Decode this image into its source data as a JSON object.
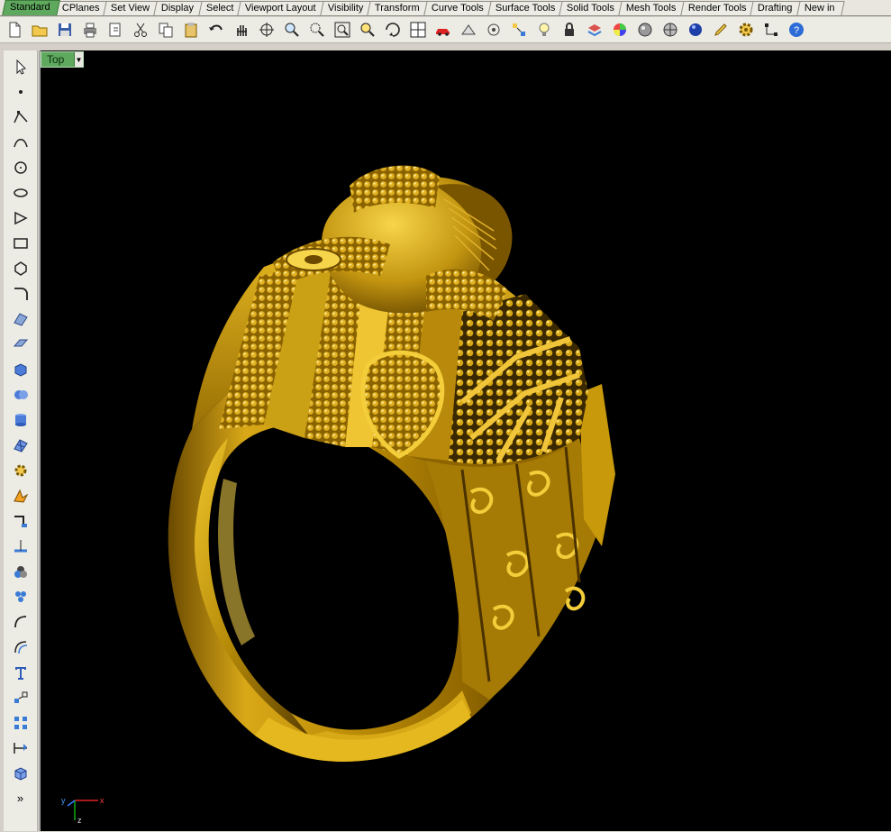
{
  "tabs": [
    "Standard",
    "CPlanes",
    "Set View",
    "Display",
    "Select",
    "Viewport Layout",
    "Visibility",
    "Transform",
    "Curve Tools",
    "Surface Tools",
    "Solid Tools",
    "Mesh Tools",
    "Render Tools",
    "Drafting",
    "New in"
  ],
  "active_tab": "Standard",
  "toolbar_icons": [
    "new-file-icon",
    "open-folder-icon",
    "save-icon",
    "print-icon",
    "import-icon",
    "cut-icon",
    "copy-icon",
    "paste-icon",
    "undo-icon",
    "pan-hand-icon",
    "rotate-view-icon",
    "zoom-icon",
    "zoom-window-icon",
    "zoom-extents-icon",
    "zoom-selected-icon",
    "rotate-view-3d-icon",
    "four-viewports-icon",
    "car-icon",
    "object-properties-icon",
    "cplane-icon",
    "snap-icon",
    "light-bulb-icon",
    "lock-icon",
    "layer-icon",
    "color-wheel-icon",
    "shade-icon",
    "rendered-icon",
    "render-sphere-icon",
    "pen-icon",
    "options-gear-icon",
    "osnap-icon",
    "help-icon"
  ],
  "left_tools": [
    "select-arrow-icon",
    "point-icon",
    "polyline-icon",
    "curve-icon",
    "circle-icon",
    "ellipse-icon",
    "arc-icon",
    "rectangle-icon",
    "polygon-icon",
    "fillet-icon",
    "surface-icon",
    "extrude-icon",
    "box-icon",
    "solid-union-icon",
    "cylinder-icon",
    "mesh-icon",
    "transform-icon",
    "explode-icon",
    "trim-icon",
    "split-icon",
    "boolean-icon",
    "group-icon",
    "curve-fillet-icon",
    "offset-icon",
    "text-icon",
    "scale-icon",
    "array-icon",
    "dimension-icon",
    "cube-view-icon"
  ],
  "left_more": "»",
  "viewport": {
    "label": "Top",
    "dropdown_icon": "chevron-down-icon"
  },
  "axes": {
    "x": "x",
    "y": "y",
    "z": "z"
  },
  "colors": {
    "gold": "#d4a10a",
    "viewport_bg": "#000000",
    "active_tab": "#5ea95e"
  }
}
